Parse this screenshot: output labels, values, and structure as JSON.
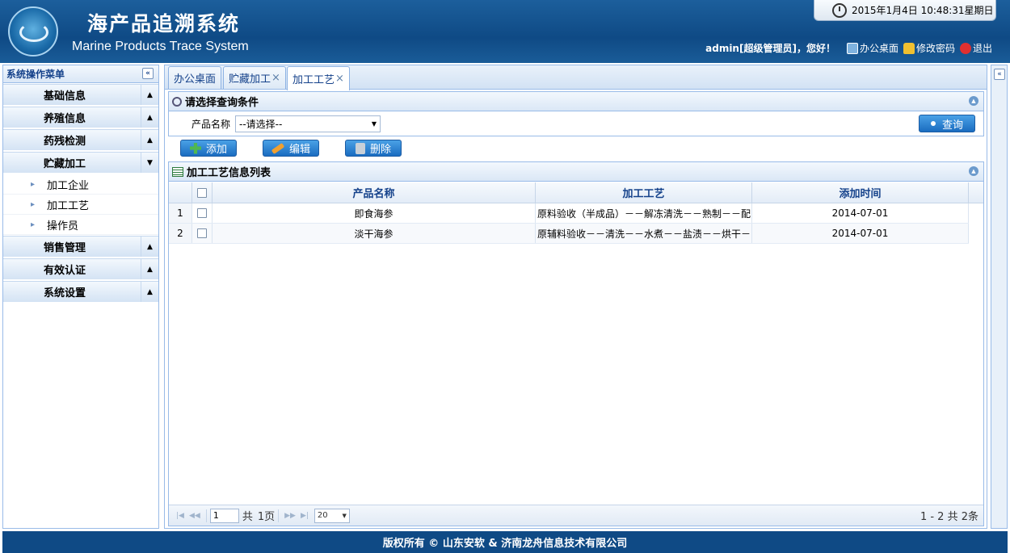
{
  "header": {
    "title_cn": "海产品追溯系统",
    "title_en": "Marine Products Trace System",
    "datetime": "2015年1月4日  10:48:31星期日",
    "user": "admin[超级管理员]，您好！",
    "links": [
      "办公桌面",
      "修改密码",
      "退出"
    ]
  },
  "sidebar": {
    "title": "系统操作菜单",
    "sections": [
      {
        "label": "基础信息",
        "arrow": "▲"
      },
      {
        "label": "养殖信息",
        "arrow": "▲"
      },
      {
        "label": "药残检测",
        "arrow": "▲"
      },
      {
        "label": "贮藏加工",
        "arrow": "▼"
      }
    ],
    "sub_items": [
      "加工企业",
      "加工工艺",
      "操作员"
    ],
    "sections_after": [
      {
        "label": "销售管理",
        "arrow": "▲"
      },
      {
        "label": "有效认证",
        "arrow": "▲"
      },
      {
        "label": "系统设置",
        "arrow": "▲"
      }
    ]
  },
  "tabs": [
    {
      "label": "办公桌面",
      "closable": false
    },
    {
      "label": "贮藏加工",
      "closable": true
    },
    {
      "label": "加工工艺",
      "closable": true,
      "active": true
    }
  ],
  "query": {
    "title": "请选择查询条件",
    "field_label": "产品名称",
    "select_value": "--请选择--",
    "button": "查询"
  },
  "toolbar": {
    "add": "添加",
    "edit": "编辑",
    "delete": "删除"
  },
  "grid": {
    "title": "加工工艺信息列表",
    "columns": [
      "产品名称",
      "加工工艺",
      "添加时间"
    ],
    "rows": [
      {
        "num": "1",
        "name": "即食海参",
        "process": "原料验收（半成品）－－解冻清洗－－熟制－－配",
        "date": "2014-07-01"
      },
      {
        "num": "2",
        "name": "淡干海参",
        "process": "原辅料验收－－清洗－－水煮－－盐渍－－烘干－",
        "date": "2014-07-01"
      }
    ]
  },
  "pager": {
    "page": "1",
    "of_label": "共",
    "total_pages": "1页",
    "page_size": "20",
    "info": "1 - 2   共 2条"
  },
  "footer": "版权所有 © 山东安软 & 济南龙舟信息技术有限公司",
  "colors": {
    "header_bg": "#0f4a85",
    "panel_border": "#99bbe8",
    "button_blue": "#1a6cc0"
  }
}
